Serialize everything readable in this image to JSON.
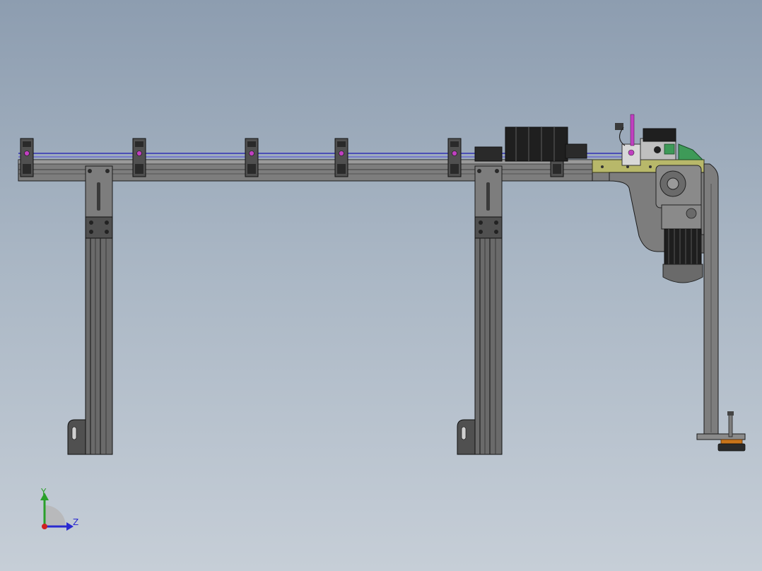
{
  "viewport": {
    "background_top": "#8d9db0",
    "background_bottom": "#c6ced7"
  },
  "colors": {
    "frame": "#7d7d7d",
    "frame_dark": "#3a3a3a",
    "outline": "#1a1a1a",
    "rail_blue": "#4b4fb5",
    "bracket": "#505050",
    "magenta": "#c040c0",
    "olive": "#b8b86a",
    "green": "#3e9a58",
    "motor": "#1e1e1e",
    "foot": "#c8741a"
  },
  "model": {
    "name": "conveyor-frame-side-view",
    "bracket_count": 6,
    "leg_count": 2,
    "icons": [
      "rail-clamp-icon",
      "support-leg-icon",
      "gear-motor-icon",
      "cylinder-icon",
      "leveling-foot-icon"
    ]
  },
  "triad": {
    "y_label": "Y",
    "z_label": "Z",
    "y_color": "#2aa02a",
    "z_color": "#2a2ad0",
    "x_color": "#d02020"
  }
}
